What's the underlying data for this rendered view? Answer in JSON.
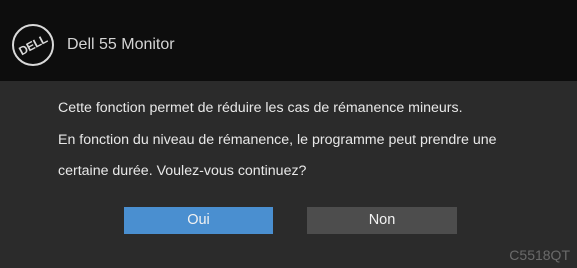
{
  "window": {
    "logo_text": "DELL",
    "title": "Dell 55 Monitor"
  },
  "message": {
    "line1": "Cette fonction permet de réduire les cas de rémanence mineurs.",
    "line2": "En fonction du niveau de rémanence, le programme peut prendre une",
    "line3": "certaine durée. Voulez-vous continuez?"
  },
  "buttons": {
    "yes_label": "Oui",
    "no_label": "Non"
  },
  "footer": {
    "model": "C5518QT"
  },
  "colors": {
    "titlebar": "#0d0d0d",
    "background": "#2b2b2b",
    "yes_button": "#4a8fd0",
    "no_button": "#4d4d4d"
  }
}
